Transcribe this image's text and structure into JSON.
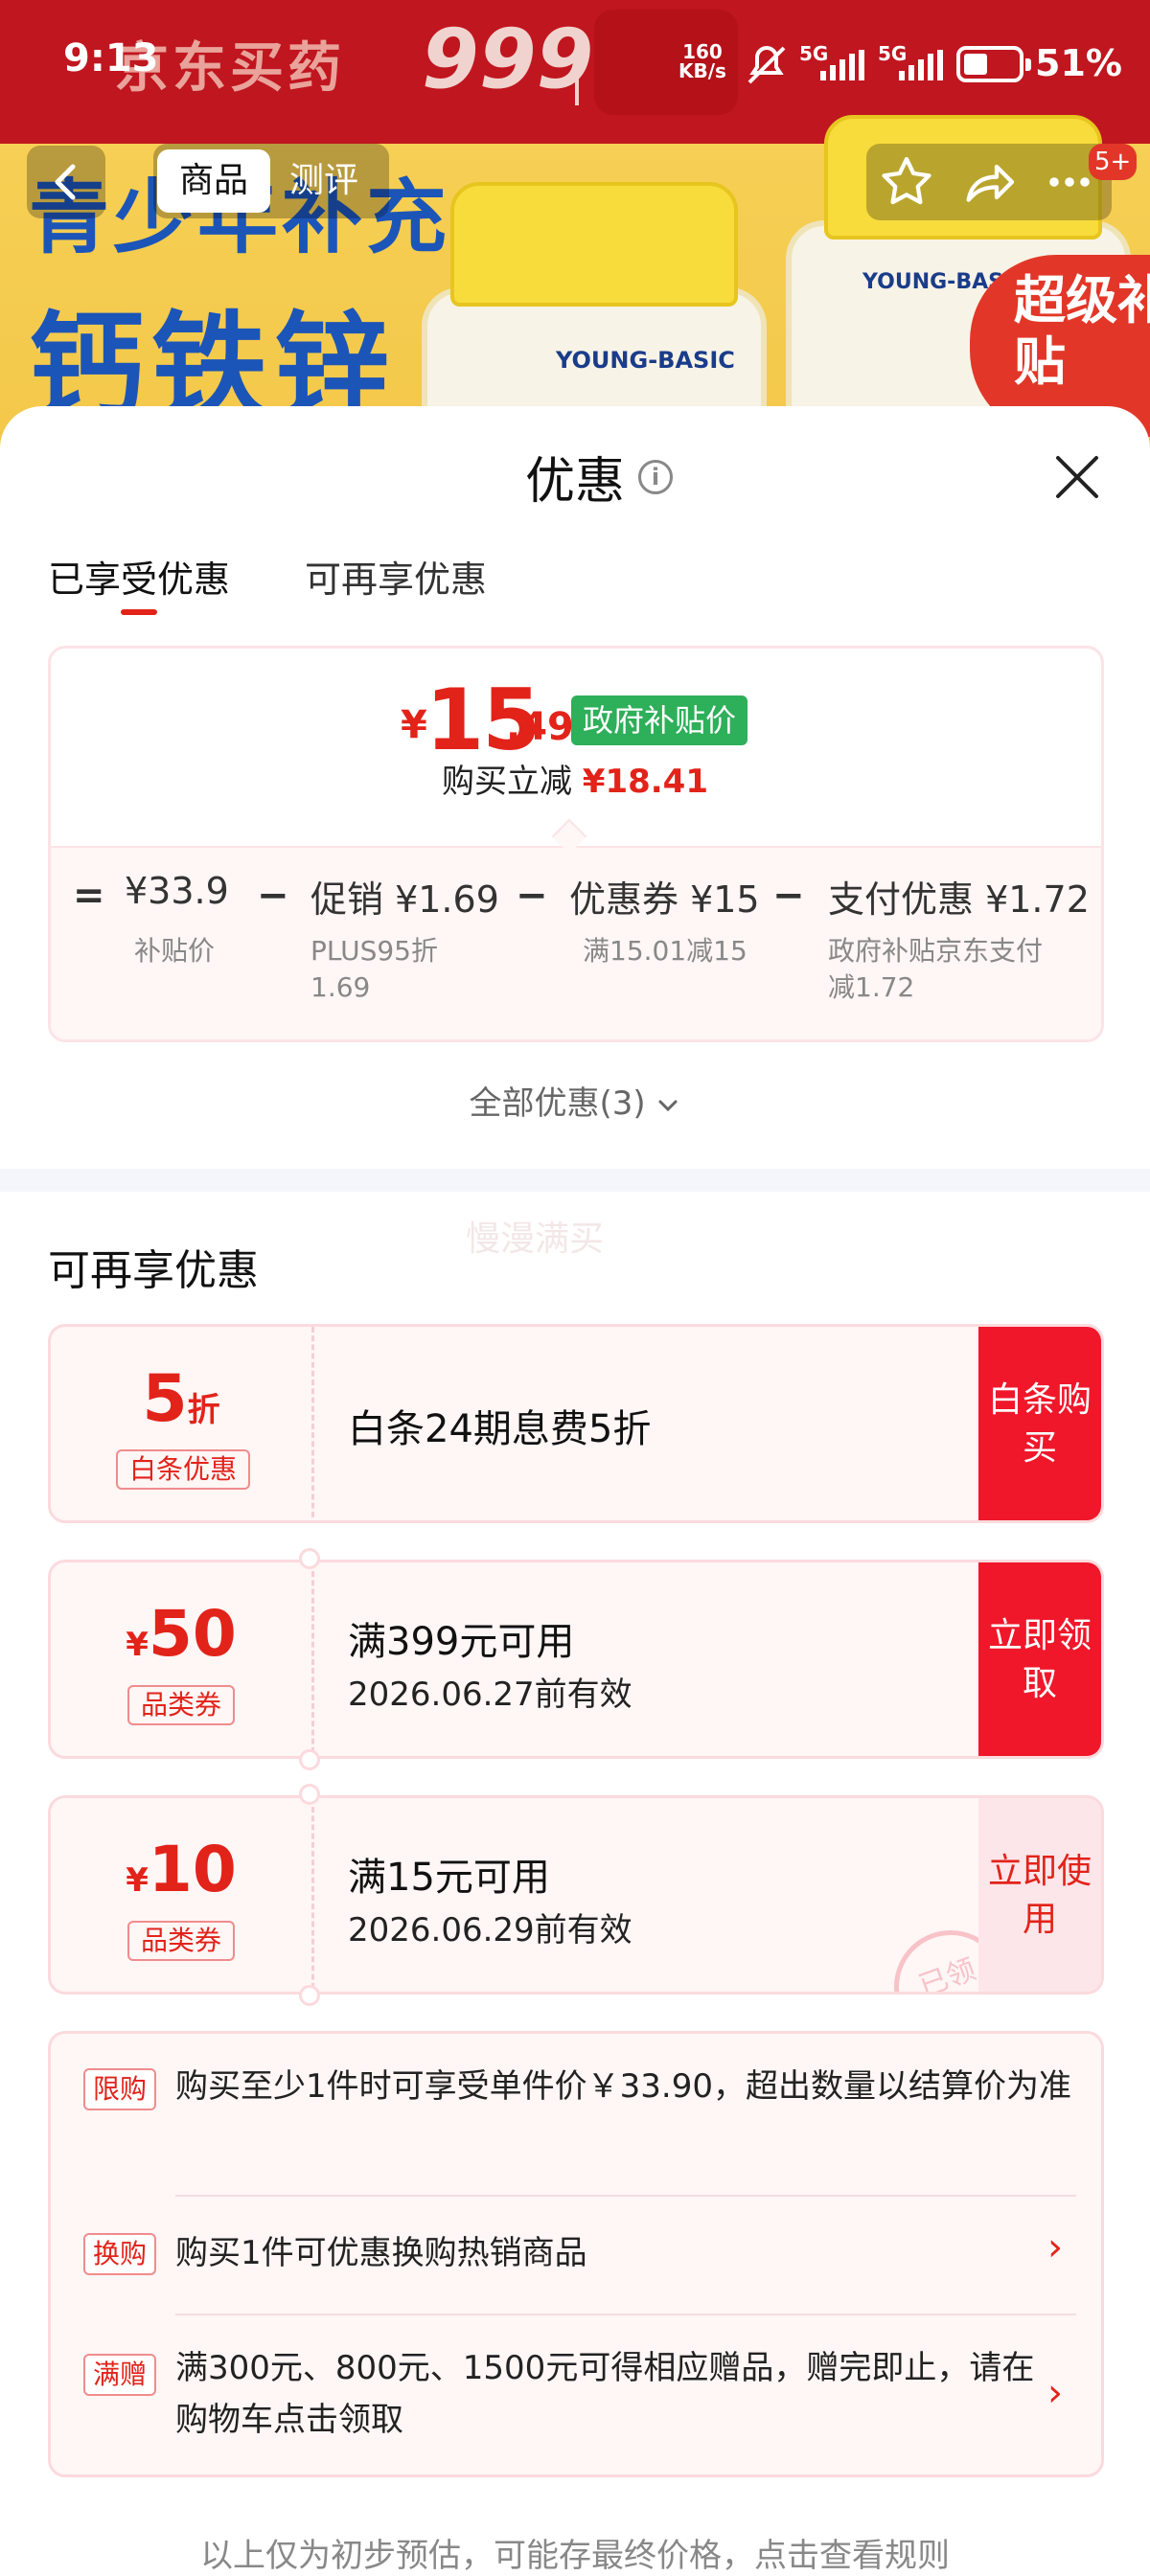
{
  "status_bar": {
    "time": "9:13",
    "net_speed_value": "160",
    "net_speed_unit": "KB/s",
    "signal_1": "5G",
    "signal_2": "5G",
    "battery_percent": "51%",
    "battery_level": 0.51
  },
  "background": {
    "brand": "京东买药",
    "number_logo": "999",
    "headline_1": "青少年补充",
    "headline_2": "钙铁锌",
    "product_brand": "YOUNG-BASIC",
    "super_badge": "超级补贴"
  },
  "nav": {
    "tab_product": "商品",
    "tab_review": "测评",
    "badge": "5+"
  },
  "sheet": {
    "title": "优惠",
    "tab_enjoyed": "已享受优惠",
    "tab_more": "可再享优惠"
  },
  "summary": {
    "currency": "¥",
    "price_int": "15",
    "price_dec": ".49",
    "price_tag": "政府补贴价",
    "reduce_label": "购买立减",
    "reduce_value": "¥18.41",
    "items": [
      {
        "op": "=",
        "value": "¥33.9",
        "desc": "补贴价"
      },
      {
        "op": "−",
        "value": "促销 ¥1.69",
        "desc": "PLUS95折\n1.69"
      },
      {
        "op": "−",
        "value": "优惠券 ¥15",
        "desc": "满15.01减15"
      },
      {
        "op": "−",
        "value": "支付优惠 ¥1.72",
        "desc": "政府补贴京东支付\n减1.72"
      }
    ],
    "all_promos": "全部优惠(3)"
  },
  "section": {
    "watermark": "慢漫满买",
    "title": "可再享优惠"
  },
  "coupons": [
    {
      "value": "5",
      "unit": "折",
      "tag": "白条优惠",
      "line1": "白条24期息费5折",
      "line2": "",
      "action": "白条购买"
    },
    {
      "currency": "¥",
      "value": "50",
      "tag": "品类券",
      "line1": "满399元可用",
      "line2": "2026.06.27前有效",
      "action": "立即领取"
    },
    {
      "currency": "¥",
      "value": "10",
      "tag": "品类券",
      "line1": "满15元可用",
      "line2": "2026.06.29前有效",
      "action": "立即使用",
      "stamp": "已领"
    }
  ],
  "rules": [
    {
      "tag": "限购",
      "text": "购买至少1件时可享受单件价￥33.90，超出数量以结算价为准"
    },
    {
      "tag": "换购",
      "text": "购买1件可优惠换购热销商品",
      "arrow": "›"
    },
    {
      "tag": "满赠",
      "text": "满300元、800元、1500元可得相应赠品，赠完即止，请在购物车点击领取",
      "arrow": "›"
    }
  ],
  "footnote": "以上仅为初步预估，可能存最终价格，点击查看规则",
  "colors": {
    "accent": "#e2231a",
    "green_tag": "#2eaf5a",
    "card_bg": "#fff6f6"
  }
}
